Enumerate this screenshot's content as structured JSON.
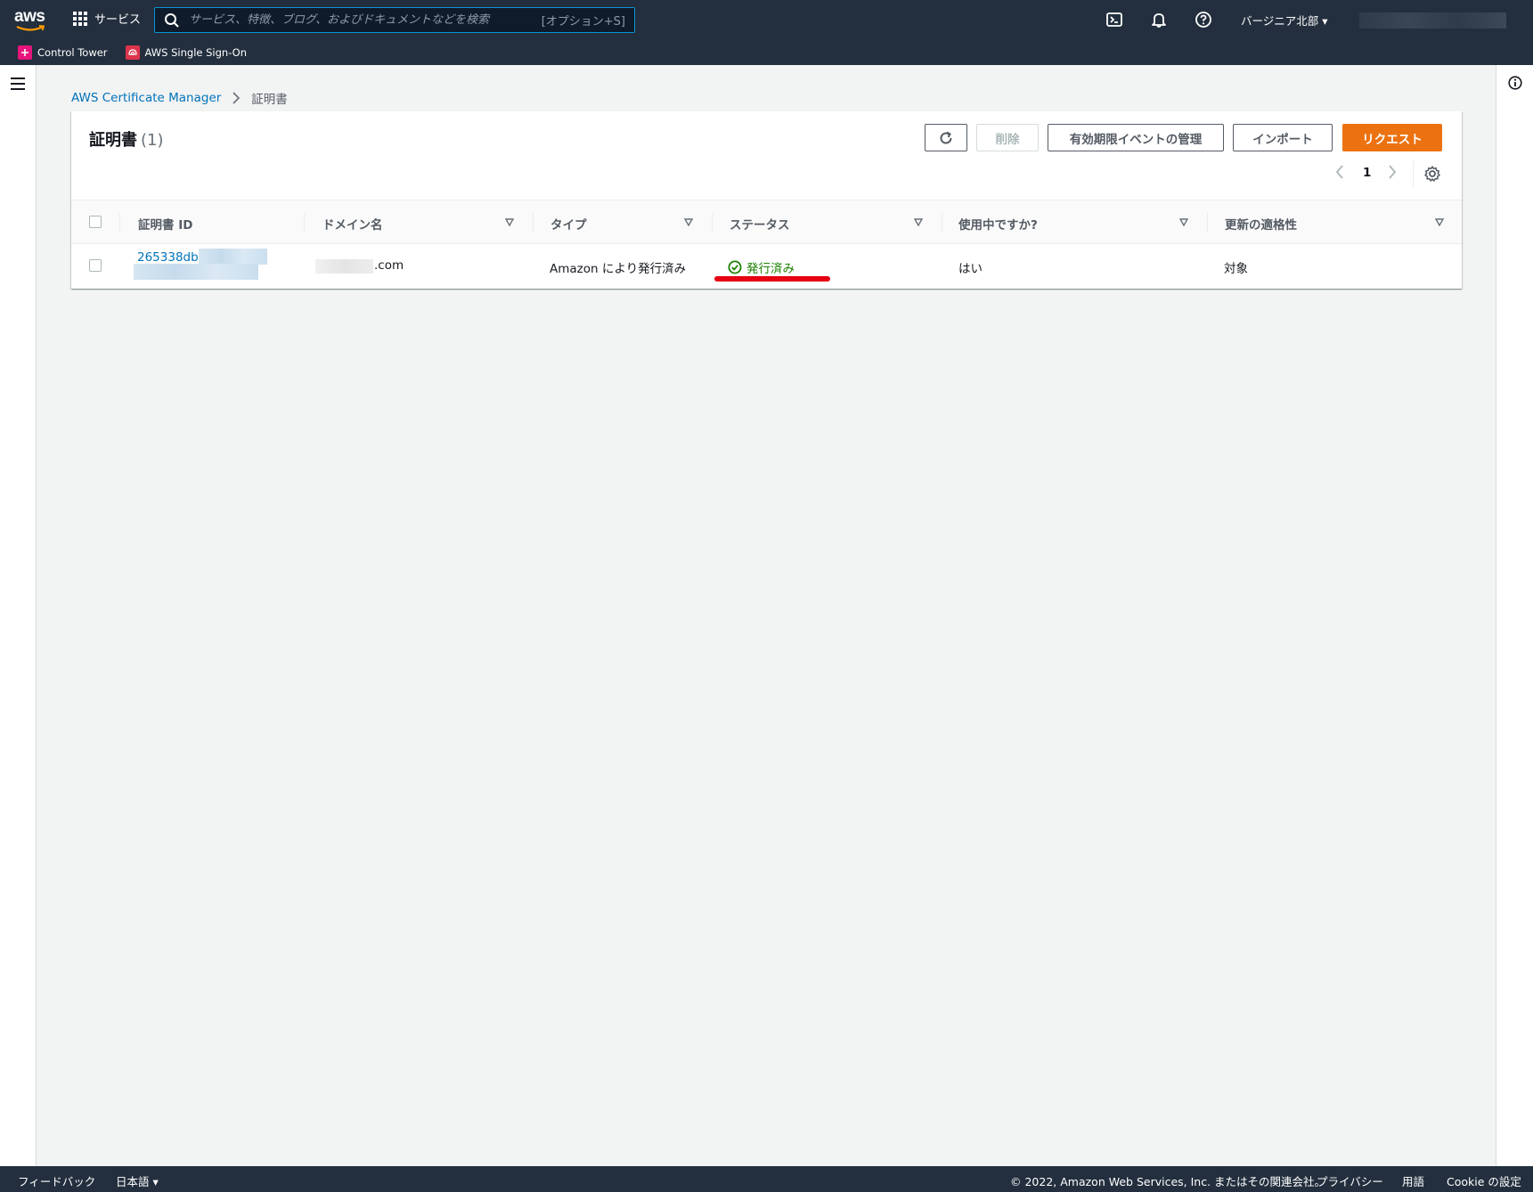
{
  "topnav": {
    "logo_text": "aws",
    "services_label": "サービス",
    "search_placeholder": "サービス、特徴、ブログ、およびドキュメントなどを検索",
    "search_shortcut": "[オプション+S]",
    "region_label": "バージニア北部 ▾",
    "favorites": [
      {
        "label": "Control Tower",
        "color": "#e7157b"
      },
      {
        "label": "AWS Single Sign-On",
        "color": "#dd344c"
      }
    ]
  },
  "breadcrumb": {
    "root": "AWS Certificate Manager",
    "current": "証明書"
  },
  "panel": {
    "title": "証明書",
    "count": "(1)",
    "buttons": {
      "delete": "削除",
      "manage_expiry": "有効期限イベントの管理",
      "import": "インポート",
      "request": "リクエスト"
    },
    "page_number": "1"
  },
  "table": {
    "columns": [
      "証明書 ID",
      "ドメイン名",
      "タイプ",
      "ステータス",
      "使用中ですか?",
      "更新の適格性"
    ],
    "rows": [
      {
        "certificate_id": "265338db-",
        "domain": ".com",
        "type": "Amazon により発行済み",
        "status": "発行済み",
        "in_use": "はい",
        "renewal_eligibility": "対象"
      }
    ]
  },
  "footer": {
    "feedback": "フィードバック",
    "language": "日本語 ▾",
    "copyright": "© 2022, Amazon Web Services, Inc. またはその関連会社。",
    "privacy": "プライバシー",
    "terms": "用語",
    "cookie": "Cookie の設定"
  },
  "colors": {
    "nav_bg": "#232f3e",
    "link": "#0073bb",
    "primary": "#ec7211",
    "success": "#1d8102",
    "annotation_red": "#e60012"
  }
}
